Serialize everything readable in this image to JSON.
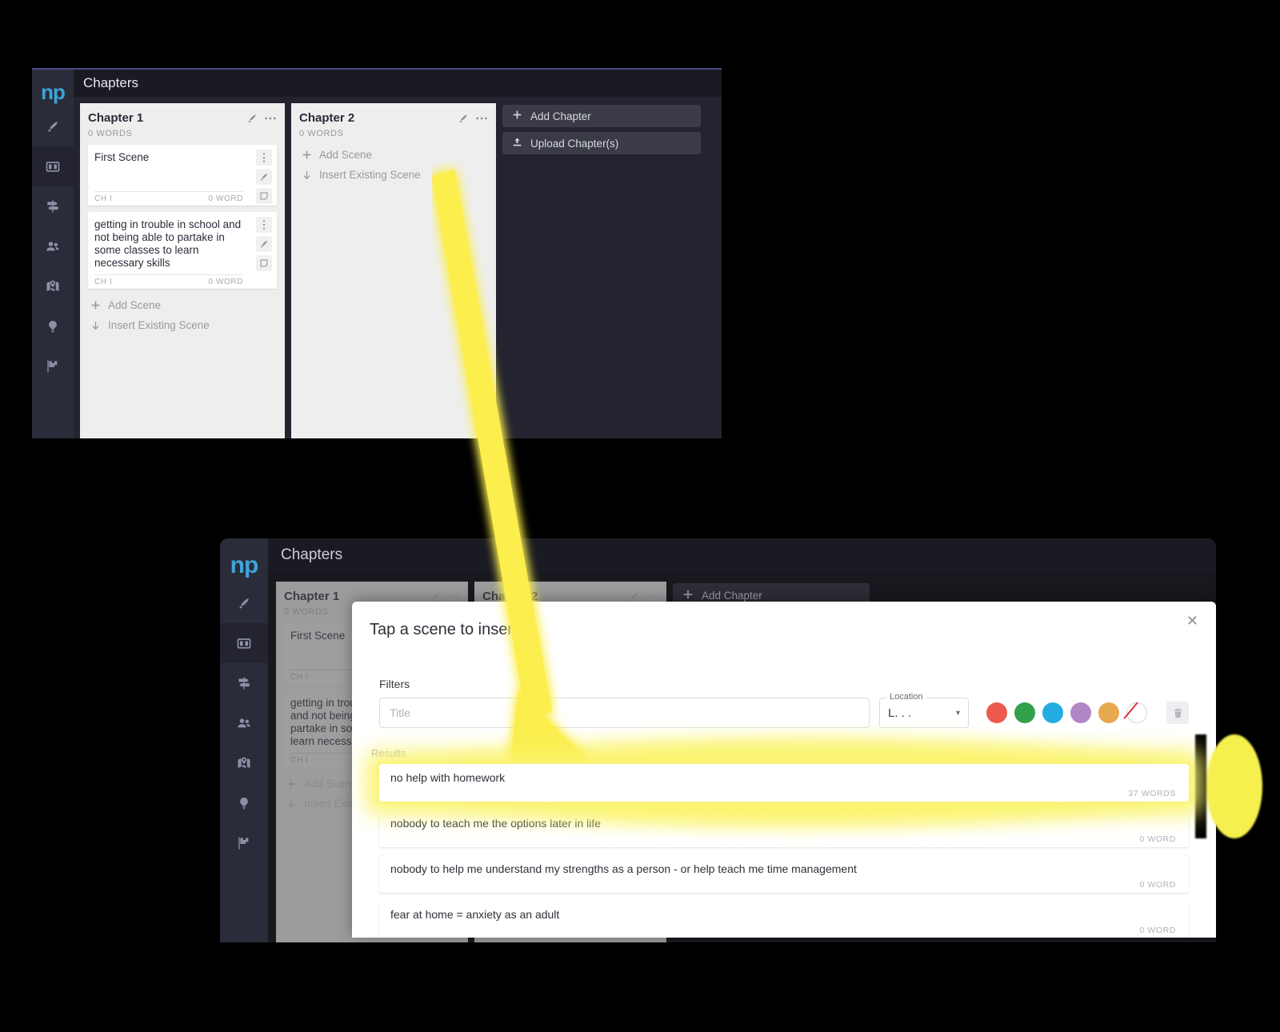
{
  "app": {
    "logo_text": "np",
    "header_title": "Chapters",
    "rail_items": [
      {
        "name": "write-pen-icon",
        "label": "Write"
      },
      {
        "name": "board-icon",
        "label": "Board"
      },
      {
        "name": "signpost-icon",
        "label": "Plot"
      },
      {
        "name": "characters-icon",
        "label": "Characters"
      },
      {
        "name": "locations-map-icon",
        "label": "Locations"
      },
      {
        "name": "lightbulb-icon",
        "label": "Ideas"
      },
      {
        "name": "finish-flag-icon",
        "label": "Goals"
      }
    ]
  },
  "board": {
    "chapters": [
      {
        "name": "Chapter 1",
        "word_count": "0 WORDS",
        "scenes": [
          {
            "title": "First Scene",
            "chapter_tag": "CH I",
            "words": "0 WORD"
          },
          {
            "title": "getting in trouble in school and not being able to partake in some classes to learn necessary skills",
            "chapter_tag": "CH I",
            "words": "0 WORD"
          }
        ],
        "add_scene_label": "Add Scene",
        "insert_existing_label": "Insert Existing Scene"
      },
      {
        "name": "Chapter 2",
        "word_count": "0 WORDS",
        "scenes": [],
        "add_scene_label": "Add Scene",
        "insert_existing_label": "Insert Existing Scene"
      }
    ],
    "add_chapter_label": "Add Chapter",
    "upload_chapters_label": "Upload Chapter(s)"
  },
  "modal": {
    "title": "Tap a scene to insert it",
    "close_label": "✕",
    "filters_label": "Filters",
    "title_placeholder": "Title",
    "title_value": "",
    "location": {
      "legend": "Location",
      "value": "L. . .",
      "caret": "▾"
    },
    "color_swatches": [
      {
        "name": "swatch-red",
        "hex": "#ec5a4d"
      },
      {
        "name": "swatch-green",
        "hex": "#33a14c"
      },
      {
        "name": "swatch-blue",
        "hex": "#23ace0"
      },
      {
        "name": "swatch-purple",
        "hex": "#b286c4"
      },
      {
        "name": "swatch-orange",
        "hex": "#e8a84e"
      },
      {
        "name": "swatch-none",
        "hex": "#ffffff"
      }
    ],
    "trash_label": "Clear filters",
    "results_label": "Results",
    "results": [
      {
        "title": "no help with homework",
        "words": "37 WORDS",
        "highlighted": true
      },
      {
        "title": "nobody to teach me the options later in life",
        "words": "0 WORD",
        "highlighted": false
      },
      {
        "title": "nobody to help me understand my strengths as a person - or help teach me time management",
        "words": "0 WORD",
        "highlighted": false
      },
      {
        "title": "fear at home = anxiety as an adult",
        "words": "0 WORD",
        "highlighted": false
      }
    ]
  },
  "annotation": {
    "arrow_color": "#fbee4e",
    "arrow_description": "arrow pointing from Insert Existing Scene to the first result row"
  }
}
